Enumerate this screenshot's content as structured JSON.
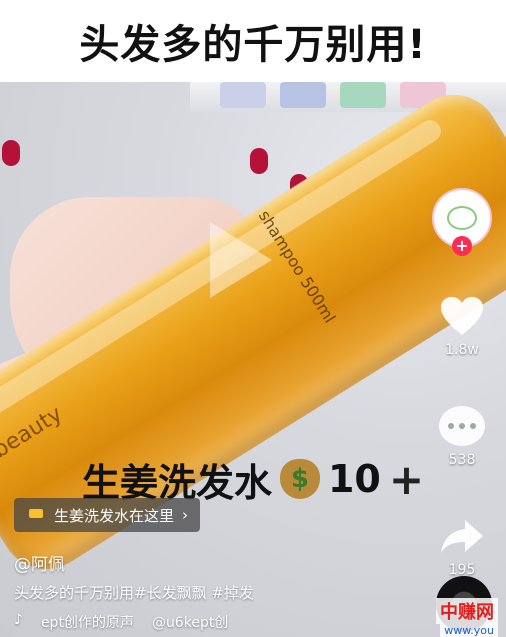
{
  "top_banner": {
    "title": "头发多的千万别用!"
  },
  "video": {
    "bottle_brand": "beauty",
    "bottle_label": "shampoo 500ml",
    "overlay_caption": "生姜洗发水",
    "price_value": "10",
    "price_suffix": "+"
  },
  "right_rail": {
    "follow_symbol": "+",
    "like_count": "1.8w",
    "comment_count": "538",
    "share_count": "195"
  },
  "shop_link": {
    "label": "生姜洗发水在这里",
    "chevron": "›"
  },
  "post": {
    "author": "@阿佩",
    "description": "头发多的千万别用#长发飘飘 #掉发",
    "music_text": "ept创作的原声",
    "music_author": "@u6kept创"
  },
  "site_watermark": {
    "name": "中赚网",
    "url": "www.you"
  },
  "colors": {
    "accent": "#fe2c55",
    "bottle": "#e9a018",
    "coin": "#b98a3a"
  }
}
